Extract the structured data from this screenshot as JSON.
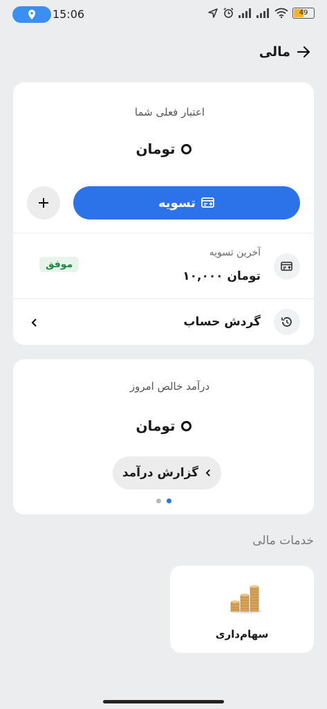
{
  "status_bar": {
    "time": "15:06",
    "battery": "49"
  },
  "header": {
    "title": "مالی"
  },
  "credit": {
    "label": "اعتبار فعلی شما",
    "currency": "تومان",
    "settle_label": "تسویه"
  },
  "last_settlement": {
    "label": "آخرین تسویه",
    "amount": "۱۰,۰۰۰ تومان",
    "status": "موفق"
  },
  "account_history": {
    "label": "گردش حساب"
  },
  "income": {
    "label": "درآمد خالص امروز",
    "currency": "تومان",
    "report_label": "گزارش درآمد"
  },
  "services": {
    "title": "خدمات مالی",
    "items": [
      {
        "label": "سهام‌داری",
        "icon": "coins-icon"
      }
    ]
  },
  "colors": {
    "accent": "#2c72e8",
    "success": "#1b8a45",
    "background": "#ebedee"
  }
}
